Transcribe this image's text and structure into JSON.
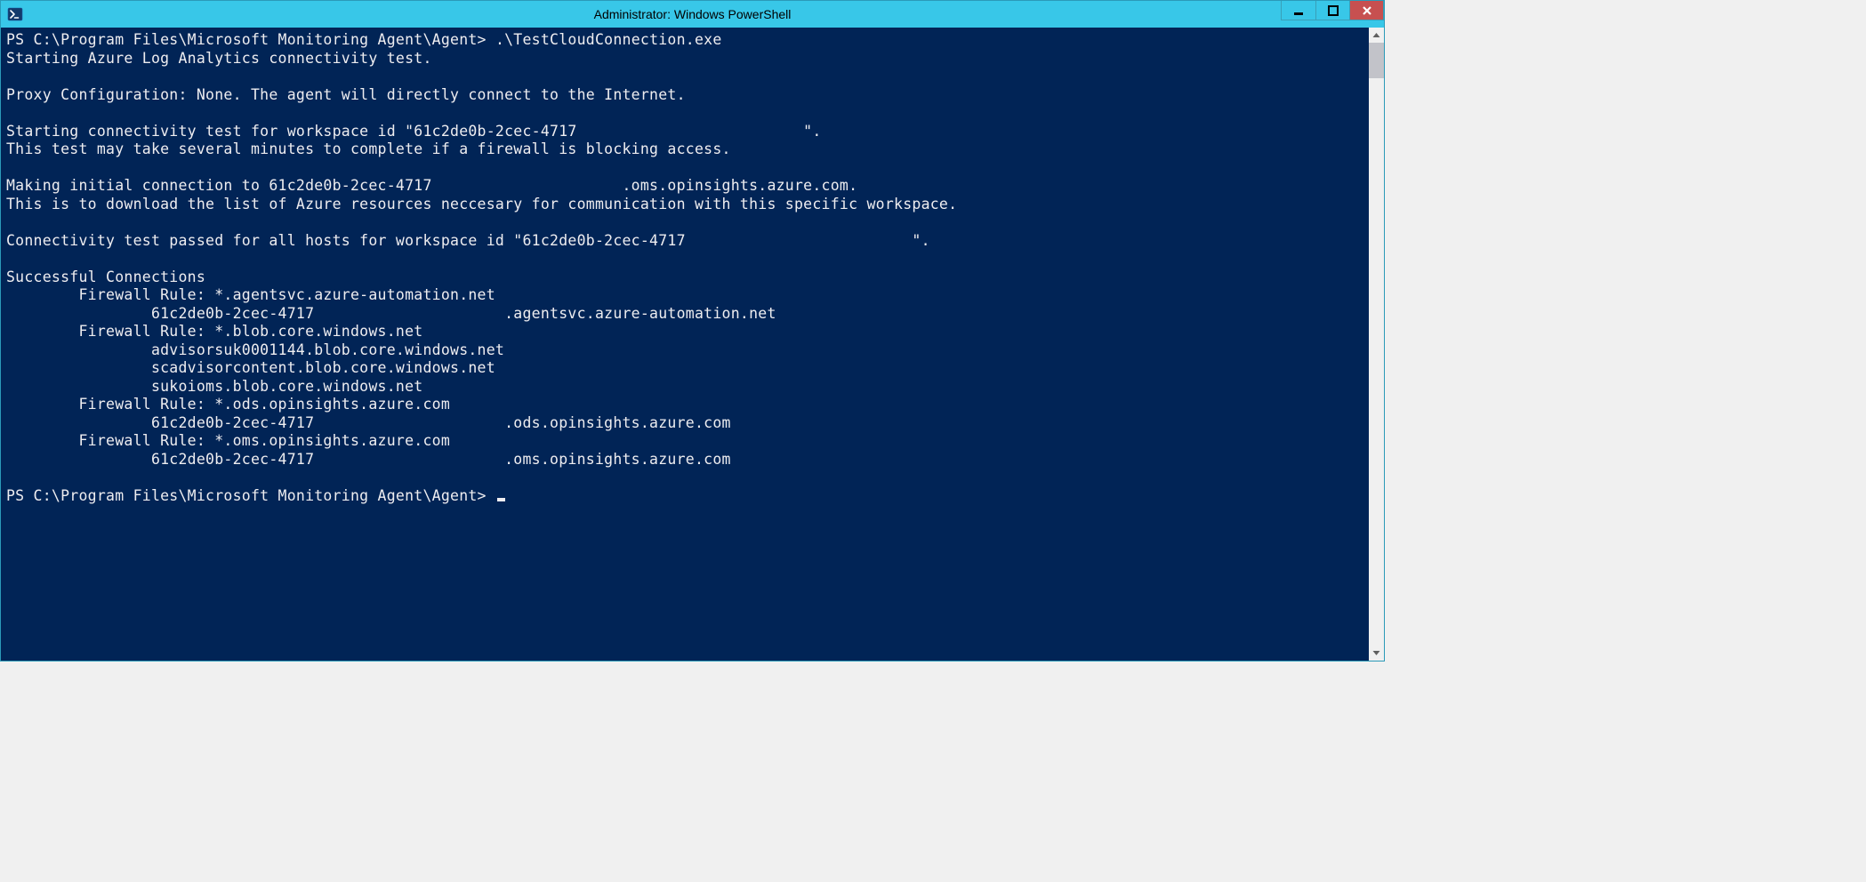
{
  "window": {
    "title": "Administrator: Windows PowerShell"
  },
  "terminal": {
    "prompt1": "PS C:\\Program Files\\Microsoft Monitoring Agent\\Agent> ",
    "command1": ".\\TestCloudConnection.exe",
    "line2": "Starting Azure Log Analytics connectivity test.",
    "line4": "Proxy Configuration: None. The agent will directly connect to the Internet.",
    "line6": "Starting connectivity test for workspace id \"61c2de0b-2cec-4717                         \".",
    "line7": "This test may take several minutes to complete if a firewall is blocking access.",
    "line9": "Making initial connection to 61c2de0b-2cec-4717                     .oms.opinsights.azure.com.",
    "line10": "This is to download the list of Azure resources neccesary for communication with this specific workspace.",
    "line12": "Connectivity test passed for all hosts for workspace id \"61c2de0b-2cec-4717                         \".",
    "line14": "Successful Connections",
    "line15": "        Firewall Rule: *.agentsvc.azure-automation.net",
    "line16": "                61c2de0b-2cec-4717                     .agentsvc.azure-automation.net",
    "line17": "        Firewall Rule: *.blob.core.windows.net",
    "line18": "                advisorsuk0001144.blob.core.windows.net",
    "line19": "                scadvisorcontent.blob.core.windows.net",
    "line20": "                sukoioms.blob.core.windows.net",
    "line21": "        Firewall Rule: *.ods.opinsights.azure.com",
    "line22": "                61c2de0b-2cec-4717                     .ods.opinsights.azure.com",
    "line23": "        Firewall Rule: *.oms.opinsights.azure.com",
    "line24": "                61c2de0b-2cec-4717                     .oms.opinsights.azure.com",
    "prompt2": "PS C:\\Program Files\\Microsoft Monitoring Agent\\Agent> "
  }
}
